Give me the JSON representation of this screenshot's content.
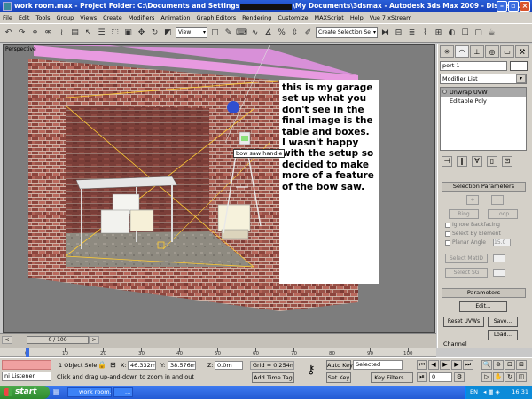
{
  "title": {
    "doc": "work room.max",
    "sep": " - Project Folder: C:\\Documents and Settings",
    "path_tail": "\\My Documents\\3dsmax",
    "app": " - Autodesk 3ds Max 2009",
    "display": " - Display..."
  },
  "menu": [
    "File",
    "Edit",
    "Tools",
    "Group",
    "Views",
    "Create",
    "Modifiers",
    "Animation",
    "Graph Editors",
    "Rendering",
    "Customize",
    "MAXScript",
    "Help",
    "Vue 7 xStream"
  ],
  "toolbar": {
    "ref_coord": "View",
    "selection_set": "Create Selection Se"
  },
  "viewport": {
    "label": "Perspective",
    "note": "this is my garage set up what you don't see in the final image is the table and boxes. I wasn't happy with the setup so decided to make more of a feature of the bow saw.",
    "bow_label": "bow saw handle"
  },
  "panel": {
    "object_name": "port 1",
    "modifier_list": "Modifier List",
    "stack": [
      {
        "label": "Unwrap UVW",
        "selected": true
      },
      {
        "label": "Editable Poly",
        "selected": false
      }
    ],
    "sel_params_title": "Selection Parameters",
    "ring": "Ring",
    "loop": "Loop",
    "ignore_backfacing": "Ignore Backfacing",
    "select_by_element": "Select By Element",
    "planar_angle": "Planar Angle",
    "planar_value": "15.0",
    "select_matid": "Select MatID",
    "select_sg": "Select SG",
    "params_title": "Parameters",
    "edit": "Edit...",
    "reset_uvws": "Reset UVWs",
    "save": "Save...",
    "load": "Load...",
    "channel": "Channel"
  },
  "timeline": {
    "slider": "0 / 100",
    "ticks": [
      "0",
      "10",
      "20",
      "30",
      "40",
      "50",
      "60",
      "70",
      "80",
      "90",
      "100"
    ]
  },
  "status": {
    "listener": "ni Listener",
    "selected": "1 Object Sele",
    "x_label": "X:",
    "x": "46.332m",
    "y_label": "Y:",
    "y": "38.576m",
    "z_label": "Z:",
    "z": "0.0m",
    "grid": "Grid = 0.254m",
    "prompt": "Click and drag up-and-down to zoom in and out",
    "add_time_tag": "Add Time Tag",
    "auto_key": "Auto Key",
    "key_mode": "Selected",
    "set_key": "Set Key",
    "key_filters": "Key Filters...",
    "frame": "0"
  },
  "taskbar": {
    "start": "start",
    "tasks": [
      "work room.max ...",
      "..."
    ],
    "lang": "EN",
    "clock": "16:31"
  },
  "colors": {
    "titlebar": "#1f4fc8",
    "chrome": "#d4d0c8",
    "brick": "#9a5048",
    "pink_plane": "#e89ae0"
  }
}
